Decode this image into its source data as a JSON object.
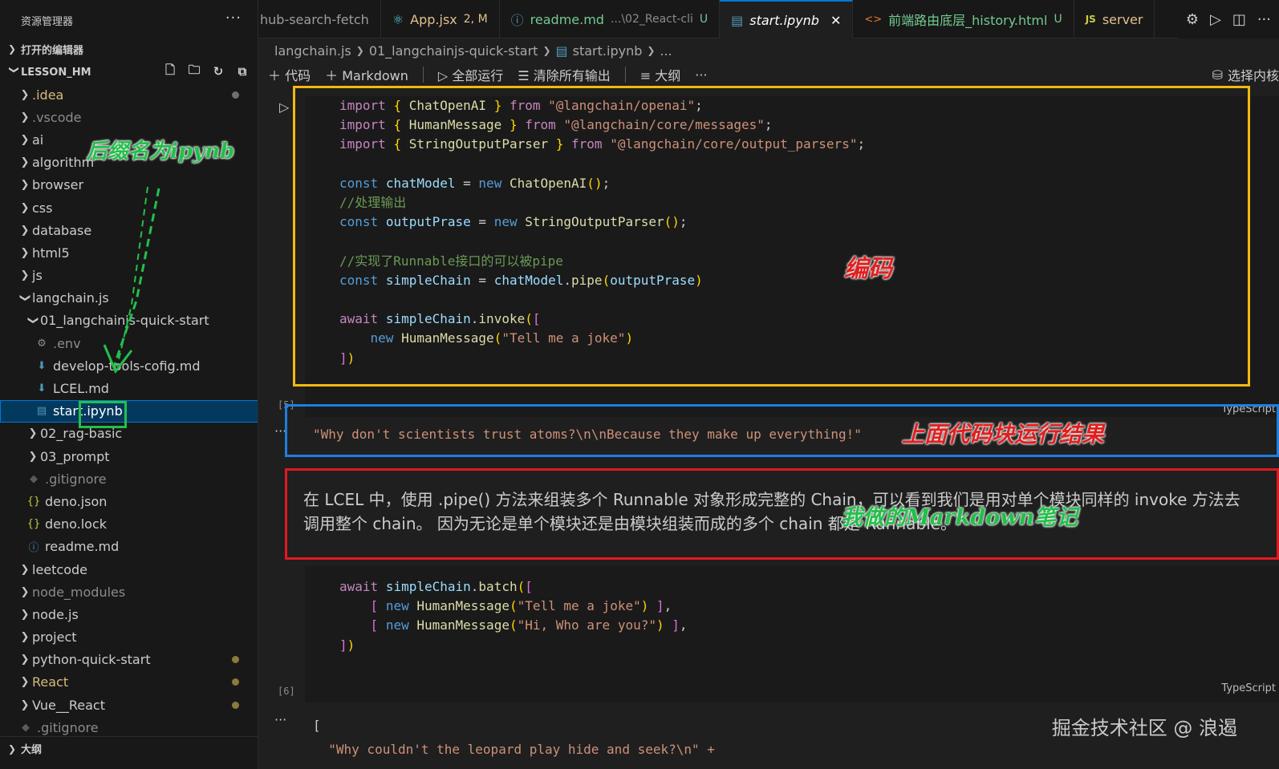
{
  "explorer": {
    "title": "资源管理器",
    "open_editors": "打开的编辑器",
    "workspace": "LESSON_HM",
    "outline": "大纲",
    "items": [
      {
        "label": ".idea",
        "indent": 0,
        "type": "folder",
        "state": "closed",
        "color": "gold",
        "dot": "gray"
      },
      {
        "label": ".vscode",
        "indent": 0,
        "type": "folder",
        "state": "closed",
        "color": "dim"
      },
      {
        "label": "ai",
        "indent": 0,
        "type": "folder",
        "state": "closed"
      },
      {
        "label": "algorithm",
        "indent": 0,
        "type": "folder",
        "state": "closed"
      },
      {
        "label": "browser",
        "indent": 0,
        "type": "folder",
        "state": "closed"
      },
      {
        "label": "css",
        "indent": 0,
        "type": "folder",
        "state": "closed"
      },
      {
        "label": "database",
        "indent": 0,
        "type": "folder",
        "state": "closed"
      },
      {
        "label": "html5",
        "indent": 0,
        "type": "folder",
        "state": "closed"
      },
      {
        "label": "js",
        "indent": 0,
        "type": "folder",
        "state": "closed"
      },
      {
        "label": "langchain.js",
        "indent": 0,
        "type": "folder",
        "state": "open"
      },
      {
        "label": "01_langchainjs-quick-start",
        "indent": 1,
        "type": "folder",
        "state": "open"
      },
      {
        "label": ".env",
        "indent": 2,
        "type": "file",
        "icon": "gear",
        "color": "dim"
      },
      {
        "label": "develop-tools-cofig.md",
        "indent": 2,
        "type": "file",
        "icon": "md"
      },
      {
        "label": "LCEL.md",
        "indent": 2,
        "type": "file",
        "icon": "md"
      },
      {
        "label": "start.ipynb",
        "indent": 2,
        "type": "file",
        "icon": "nb",
        "selected": true
      },
      {
        "label": "02_rag-basic",
        "indent": 1,
        "type": "folder",
        "state": "closed"
      },
      {
        "label": "03_prompt",
        "indent": 1,
        "type": "folder",
        "state": "closed"
      },
      {
        "label": ".gitignore",
        "indent": 1,
        "type": "file",
        "icon": "git",
        "color": "dim"
      },
      {
        "label": "deno.json",
        "indent": 1,
        "type": "file",
        "icon": "json"
      },
      {
        "label": "deno.lock",
        "indent": 1,
        "type": "file",
        "icon": "json"
      },
      {
        "label": "readme.md",
        "indent": 1,
        "type": "file",
        "icon": "info"
      },
      {
        "label": "leetcode",
        "indent": 0,
        "type": "folder",
        "state": "closed"
      },
      {
        "label": "node_modules",
        "indent": 0,
        "type": "folder",
        "state": "closed",
        "color": "dim"
      },
      {
        "label": "node.js",
        "indent": 0,
        "type": "folder",
        "state": "closed"
      },
      {
        "label": "project",
        "indent": 0,
        "type": "folder",
        "state": "closed"
      },
      {
        "label": "python-quick-start",
        "indent": 0,
        "type": "folder",
        "state": "closed",
        "dot": "gold"
      },
      {
        "label": "React",
        "indent": 0,
        "type": "folder",
        "state": "closed",
        "color": "gold",
        "dot": "gold"
      },
      {
        "label": "Vue__React",
        "indent": 0,
        "type": "folder",
        "state": "closed",
        "dot": "gold"
      },
      {
        "label": ".gitignore",
        "indent": 0,
        "type": "file",
        "icon": "git",
        "color": "dim"
      }
    ]
  },
  "tabs": [
    {
      "label": "hub-search-fetch",
      "icon": ""
    },
    {
      "label": "App.jsx",
      "icon": "⚛",
      "status": "2, M"
    },
    {
      "label": "readme.md",
      "icon": "ⓘ",
      "sub": "...\\02_React-cli",
      "status": "U"
    },
    {
      "label": "start.ipynb",
      "icon": "nb",
      "active": true
    },
    {
      "label": "前端路由底层_history.html",
      "icon": "<>",
      "status": "U"
    },
    {
      "label": "server",
      "icon": "JS"
    }
  ],
  "breadcrumb": [
    "langchain.js",
    "01_langchainjs-quick-start",
    "start.ipynb",
    "..."
  ],
  "toolbar": {
    "code": "代码",
    "markdown": "Markdown",
    "run_all": "全部运行",
    "clear_outputs": "清除所有输出",
    "outline": "大纲",
    "more": "···",
    "select_kernel": "选择内核"
  },
  "cells": {
    "cell1": {
      "exec": "[5]",
      "lang": "TypeScript",
      "lines": [
        "import { ChatOpenAI } from \"@langchain/openai\";",
        "import { HumanMessage } from \"@langchain/core/messages\";",
        "import { StringOutputParser } from \"@langchain/core/output_parsers\";",
        "",
        "const chatModel = new ChatOpenAI();",
        "//处理输出",
        "const outputPrase = new StringOutputParser();",
        "",
        "//实现了Runnable接口的可以被pipe",
        "const simpleChain = chatModel.pipe(outputPrase)",
        "",
        "await simpleChain.invoke([",
        "    new HumanMessage(\"Tell me a joke\")",
        "])"
      ]
    },
    "output1": "\"Why don't scientists trust atoms?\\n\\nBecause they make up everything!\"",
    "markdown_lines": [
      "在 LCEL 中，使用 .pipe() 方法来组装多个 Runnable 对象形成完整的 Chain，可以看到我们是用对单个模块同样的 invoke 方法去",
      "调用整个 chain。 因为无论是单个模块还是由模块组装而成的多个 chain 都是 Runnable。"
    ],
    "cell2": {
      "exec": "[6]",
      "lang": "TypeScript",
      "lines": [
        "await simpleChain.batch([",
        "    [ new HumanMessage(\"Tell me a joke\") ],",
        "    [ new HumanMessage(\"Hi, Who are you?\") ],",
        "])"
      ]
    },
    "output2": [
      "[",
      "  \"Why couldn't the leopard play hide and seek?\\n\" +"
    ]
  },
  "annotations": {
    "suffix": "后缀名为ipynb",
    "coding": "编码",
    "result": "上面代码块运行结果",
    "notes": "我做的Markdown笔记",
    "colors": {
      "yellow": "#f2b90f",
      "blue": "#1e7fe0",
      "red": "#e0191f",
      "green": "#22c04a",
      "anno_red": "#e02020"
    }
  },
  "watermark": "掘金技术社区 @ 浪遏"
}
